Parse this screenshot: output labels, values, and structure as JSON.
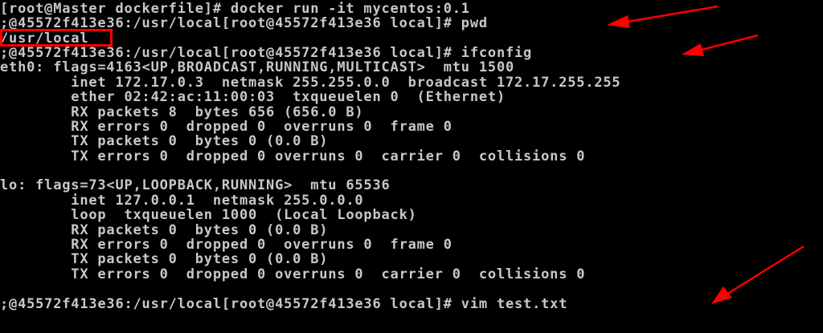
{
  "terminal": {
    "lines": [
      "[root@Master dockerfile]# docker run -it mycentos:0.1",
      ";@45572f413e36:/usr/local[root@45572f413e36 local]# pwd",
      "/usr/local",
      ";@45572f413e36:/usr/local[root@45572f413e36 local]# ifconfig",
      "eth0: flags=4163<UP,BROADCAST,RUNNING,MULTICAST>  mtu 1500",
      "        inet 172.17.0.3  netmask 255.255.0.0  broadcast 172.17.255.255",
      "        ether 02:42:ac:11:00:03  txqueuelen 0  (Ethernet)",
      "        RX packets 8  bytes 656 (656.0 B)",
      "        RX errors 0  dropped 0  overruns 0  frame 0",
      "        TX packets 0  bytes 0 (0.0 B)",
      "        TX errors 0  dropped 0 overruns 0  carrier 0  collisions 0",
      "",
      "lo: flags=73<UP,LOOPBACK,RUNNING>  mtu 65536",
      "        inet 127.0.0.1  netmask 255.0.0.0",
      "        loop  txqueuelen 1000  (Local Loopback)",
      "        RX packets 0  bytes 0 (0.0 B)",
      "        RX errors 0  dropped 0  overruns 0  frame 0",
      "        TX packets 0  bytes 0 (0.0 B)",
      "        TX errors 0  dropped 0 overruns 0  carrier 0  collisions 0",
      "",
      ";@45572f413e36:/usr/local[root@45572f413e36 local]# vim test.txt"
    ]
  },
  "colors": {
    "background": "#000000",
    "text": "#c8c8c8",
    "annotation": "#ff0000"
  }
}
